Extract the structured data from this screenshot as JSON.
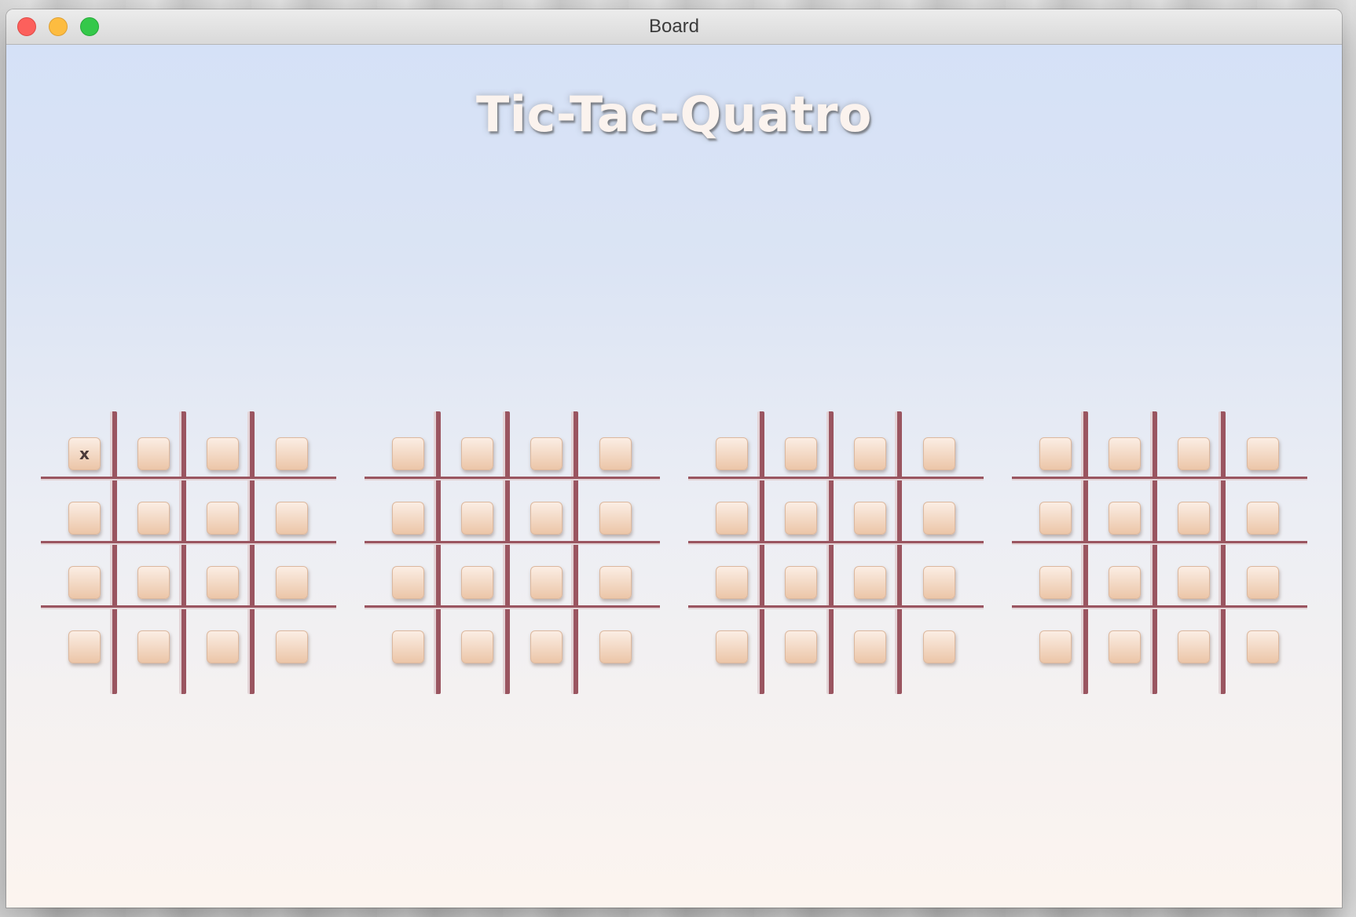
{
  "window": {
    "title": "Board"
  },
  "game": {
    "title": "Tic-Tac-Quatro"
  },
  "boards": [
    {
      "cells": [
        [
          "x",
          "",
          "",
          ""
        ],
        [
          "",
          "",
          "",
          ""
        ],
        [
          "",
          "",
          "",
          ""
        ],
        [
          "",
          "",
          "",
          ""
        ]
      ]
    },
    {
      "cells": [
        [
          "",
          "",
          "",
          ""
        ],
        [
          "",
          "",
          "",
          ""
        ],
        [
          "",
          "",
          "",
          ""
        ],
        [
          "",
          "",
          "",
          ""
        ]
      ]
    },
    {
      "cells": [
        [
          "",
          "",
          "",
          ""
        ],
        [
          "",
          "",
          "",
          ""
        ],
        [
          "",
          "",
          "",
          ""
        ],
        [
          "",
          "",
          "",
          ""
        ]
      ]
    },
    {
      "cells": [
        [
          "",
          "",
          "",
          ""
        ],
        [
          "",
          "",
          "",
          ""
        ],
        [
          "",
          "",
          "",
          ""
        ],
        [
          "",
          "",
          "",
          ""
        ]
      ]
    }
  ]
}
